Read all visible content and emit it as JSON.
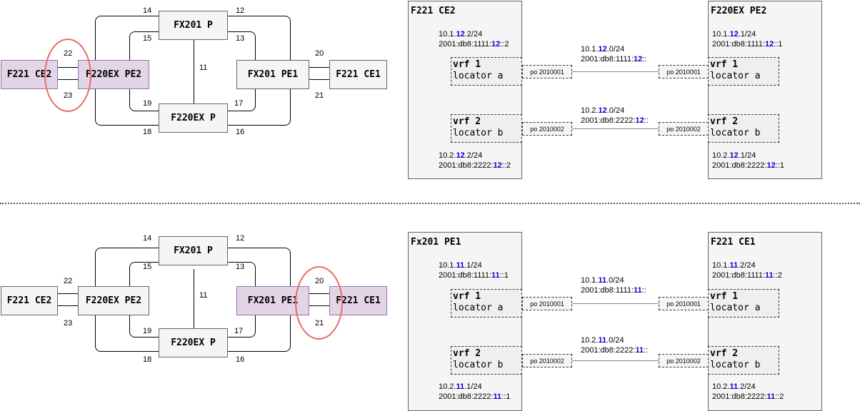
{
  "topologies": [
    {
      "nodes": {
        "ce2": "F221 CE2",
        "pe2": "F220EX PE2",
        "fx201p": "FX201 P",
        "f220exp": "F220EX P",
        "pe1": "FX201 PE1",
        "ce1": "F221 CE1"
      },
      "highlighted": [
        "ce2",
        "pe2"
      ],
      "links": {
        "l14": "14",
        "l12": "12",
        "l15": "15",
        "l13": "13",
        "l11": "11",
        "l22": "22",
        "l23": "23",
        "l20": "20",
        "l21": "21",
        "l19": "19",
        "l17": "17",
        "l18": "18",
        "l16": "16"
      }
    },
    {
      "nodes": {
        "ce2": "F221 CE2",
        "pe2": "F220EX PE2",
        "fx201p": "FX201 P",
        "f220exp": "F220EX P",
        "pe1": "FX201 PE1",
        "ce1": "F221 CE1"
      },
      "highlighted": [
        "pe1",
        "ce1"
      ],
      "links": {
        "l14": "14",
        "l12": "12",
        "l15": "15",
        "l13": "13",
        "l11": "11",
        "l22": "22",
        "l23": "23",
        "l20": "20",
        "l21": "21",
        "l19": "19",
        "l17": "17",
        "l18": "18",
        "l16": "16"
      }
    }
  ],
  "details": [
    {
      "left_title": "F221 CE2",
      "right_title": "F220EX PE2",
      "left_v4_1": [
        "10.1.",
        "12",
        ".2/24"
      ],
      "left_v6_1": [
        "2001:db8:1111:",
        "12",
        "::2"
      ],
      "right_v4_1": [
        "10.1.",
        "12",
        ".1/24"
      ],
      "right_v6_1": [
        "2001:db8:1111:",
        "12",
        "::1"
      ],
      "net_v4_1": [
        "10.1.",
        "12",
        ".0/24"
      ],
      "net_v6_1": [
        "2001:db8:1111:",
        "12",
        "::"
      ],
      "net_v4_2": [
        "10.2.",
        "12",
        ".0/24"
      ],
      "net_v6_2": [
        "2001:db8:2222:",
        "12",
        "::"
      ],
      "left_v4_2": [
        "10.2.",
        "12",
        ".2/24"
      ],
      "left_v6_2": [
        "2001:db8:2222:",
        "12",
        "::2"
      ],
      "right_v4_2": [
        "10.2.",
        "12",
        ".1/24"
      ],
      "right_v6_2": [
        "2001:db8:2222:",
        "12",
        "::1"
      ],
      "vrf1": "vrf 1",
      "loc1": "locator a",
      "vrf2": "vrf 2",
      "loc2": "locator b",
      "po1": "po 2010001",
      "po2": "po 2010002"
    },
    {
      "left_title": "Fx201 PE1",
      "right_title": "F221 CE1",
      "left_v4_1": [
        "10.1.",
        "11",
        ".1/24"
      ],
      "left_v6_1": [
        "2001:db8:1111:",
        "11",
        "::1"
      ],
      "right_v4_1": [
        "10.1.",
        "11",
        ".2/24"
      ],
      "right_v6_1": [
        "2001:db8:1111:",
        "11",
        "::2"
      ],
      "net_v4_1": [
        "10.1.",
        "11",
        ".0/24"
      ],
      "net_v6_1": [
        "2001:db8:1111:",
        "11",
        "::"
      ],
      "net_v4_2": [
        "10.2.",
        "11",
        ".0/24"
      ],
      "net_v6_2": [
        "2001:db8:2222:",
        "11",
        "::"
      ],
      "left_v4_2": [
        "10.2.",
        "11",
        ".1/24"
      ],
      "left_v6_2": [
        "2001:db8:2222:",
        "11",
        "::1"
      ],
      "right_v4_2": [
        "10.2.",
        "11",
        ".2/24"
      ],
      "right_v6_2": [
        "2001:db8:2222:",
        "11",
        "::2"
      ],
      "vrf1": "vrf 1",
      "loc1": "locator a",
      "vrf2": "vrf 2",
      "loc2": "locator b",
      "po1": "po 2010001",
      "po2": "po 2010002"
    }
  ],
  "colors": {
    "highlight_fill": "#e1d5e7",
    "highlight_border": "#9673a6",
    "circle": "#ea6b66",
    "accent_text": "#0000cc"
  }
}
